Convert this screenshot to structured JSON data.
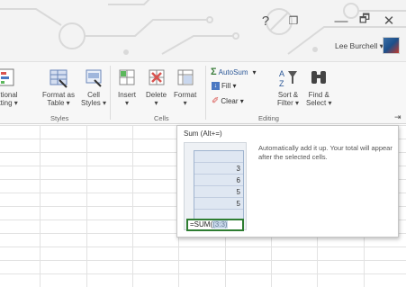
{
  "window": {
    "help_label": "?",
    "restore_label": "❐",
    "minimize_label": "—",
    "maximize_label": "🗗",
    "close_label": "✕",
    "user_name": "Lee Burchell"
  },
  "ribbon": {
    "styles_group": {
      "conditional_formatting": [
        "ditional",
        "atting ▾"
      ],
      "format_as_table": [
        "Format as",
        "Table ▾"
      ],
      "cell_styles": [
        "Cell",
        "Styles ▾"
      ],
      "label": "Styles"
    },
    "cells_group": {
      "insert": [
        "Insert",
        "▾"
      ],
      "delete": [
        "Delete",
        "▾"
      ],
      "format": [
        "Format",
        "▾"
      ],
      "label": "Cells"
    },
    "editing_group": {
      "autosum": "AutoSum",
      "fill": "Fill ▾",
      "clear": "Clear ▾",
      "sort_filter": [
        "Sort &",
        "Filter ▾"
      ],
      "find_select": [
        "Find &",
        "Select ▾"
      ],
      "label": "Editing",
      "pin": "⇥"
    }
  },
  "tooltip": {
    "title": "Sum (Alt+=)",
    "description": "Automatically add it up. Your total will appear after the selected cells.",
    "preview": {
      "values": [
        "3",
        "6",
        "5",
        "5"
      ],
      "formula_prefix": "=SUM(",
      "formula_arg": "(3:3)"
    }
  }
}
